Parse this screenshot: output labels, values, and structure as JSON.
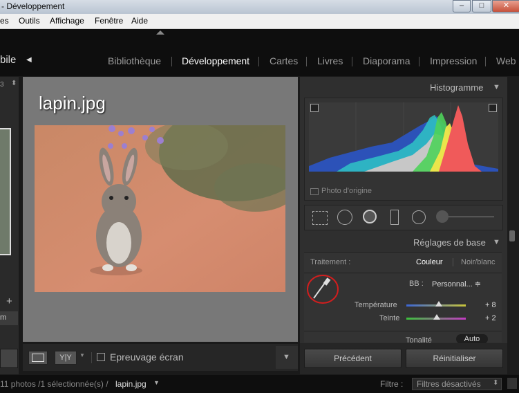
{
  "window": {
    "title": "- Développement"
  },
  "menu": [
    "es",
    "Outils",
    "Affichage",
    "Fenêtre",
    "Aide"
  ],
  "identity": {
    "label": "bile"
  },
  "modules": [
    "Bibliothèque",
    "Développement",
    "Cartes",
    "Livres",
    "Diaporama",
    "Impression",
    "Web"
  ],
  "left_panel": {
    "count_label": "3",
    "item_label": "m"
  },
  "photo": {
    "title": "lapin.jpg"
  },
  "center_toolbar": {
    "yy_label": "Y|Y",
    "proof_label": "Epreuvage écran"
  },
  "histogram": {
    "header": "Histogramme",
    "original_label": "Photo d'origine"
  },
  "basic": {
    "header": "Réglages de base",
    "treatment_label": "Traitement :",
    "color_option": "Couleur",
    "bw_option": "Noir/blanc",
    "wb_label": "BB :",
    "wb_value": "Personnal... ≑",
    "temp_label": "Température",
    "temp_value": "+ 8",
    "temp_level": 0.55,
    "tint_label": "Teinte",
    "tint_value": "+ 2",
    "tint_level": 0.51,
    "tone_label": "Tonalité",
    "auto_label": "Auto"
  },
  "buttons": {
    "previous": "Précédent",
    "reset": "Réinitialiser"
  },
  "status": {
    "photos": "11 photos /1 sélectionnée(s) /",
    "filename": "lapin.jpg",
    "filter_label": "Filtre :",
    "filter_value": "Filtres désactivés"
  }
}
